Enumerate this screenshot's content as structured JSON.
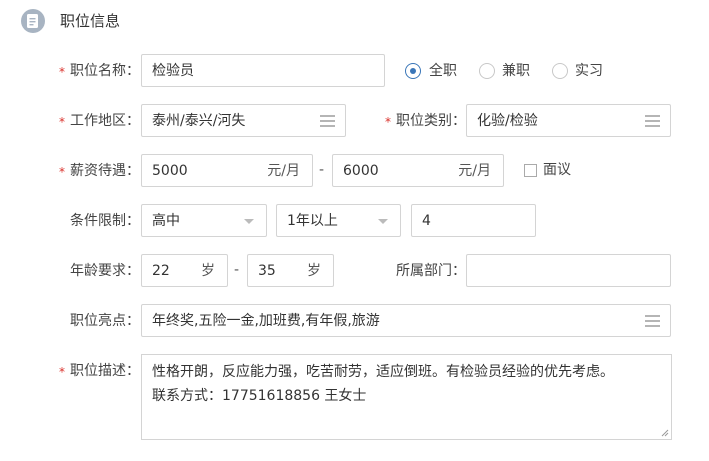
{
  "section": {
    "title": "职位信息",
    "icon": "document-icon"
  },
  "required_mark": "*",
  "job_title": {
    "label": "职位名称：",
    "value": "检验员"
  },
  "job_type": {
    "options": [
      "全职",
      "兼职",
      "实习"
    ],
    "selected": "全职"
  },
  "work_area": {
    "label": "工作地区：",
    "value": "泰州/泰兴/河失"
  },
  "job_category": {
    "label": "职位类别：",
    "value": "化验/检验"
  },
  "salary": {
    "label": "薪资待遇：",
    "min": "5000",
    "max": "6000",
    "unit": "元/月",
    "separator": "-",
    "negotiable_label": "面议",
    "negotiable": false
  },
  "conditions": {
    "label": "条件限制：",
    "education": "高中",
    "experience": "1年以上",
    "count": "4"
  },
  "age": {
    "label": "年龄要求：",
    "min": "22",
    "max": "35",
    "unit": "岁",
    "separator": "-"
  },
  "department": {
    "label": "所属部门：",
    "value": ""
  },
  "highlights": {
    "label": "职位亮点：",
    "value": "年终奖,五险一金,加班费,有年假,旅游"
  },
  "description": {
    "label": "职位描述：",
    "line1": "性格开朗，反应能力强，吃苦耐劳，适应倒班。有检验员经验的优先考虑。",
    "line2": "联系方式：17751618856 王女士"
  },
  "colors": {
    "accent": "#3a76b8",
    "required": "#d9312b",
    "border": "#d4d4d4"
  }
}
